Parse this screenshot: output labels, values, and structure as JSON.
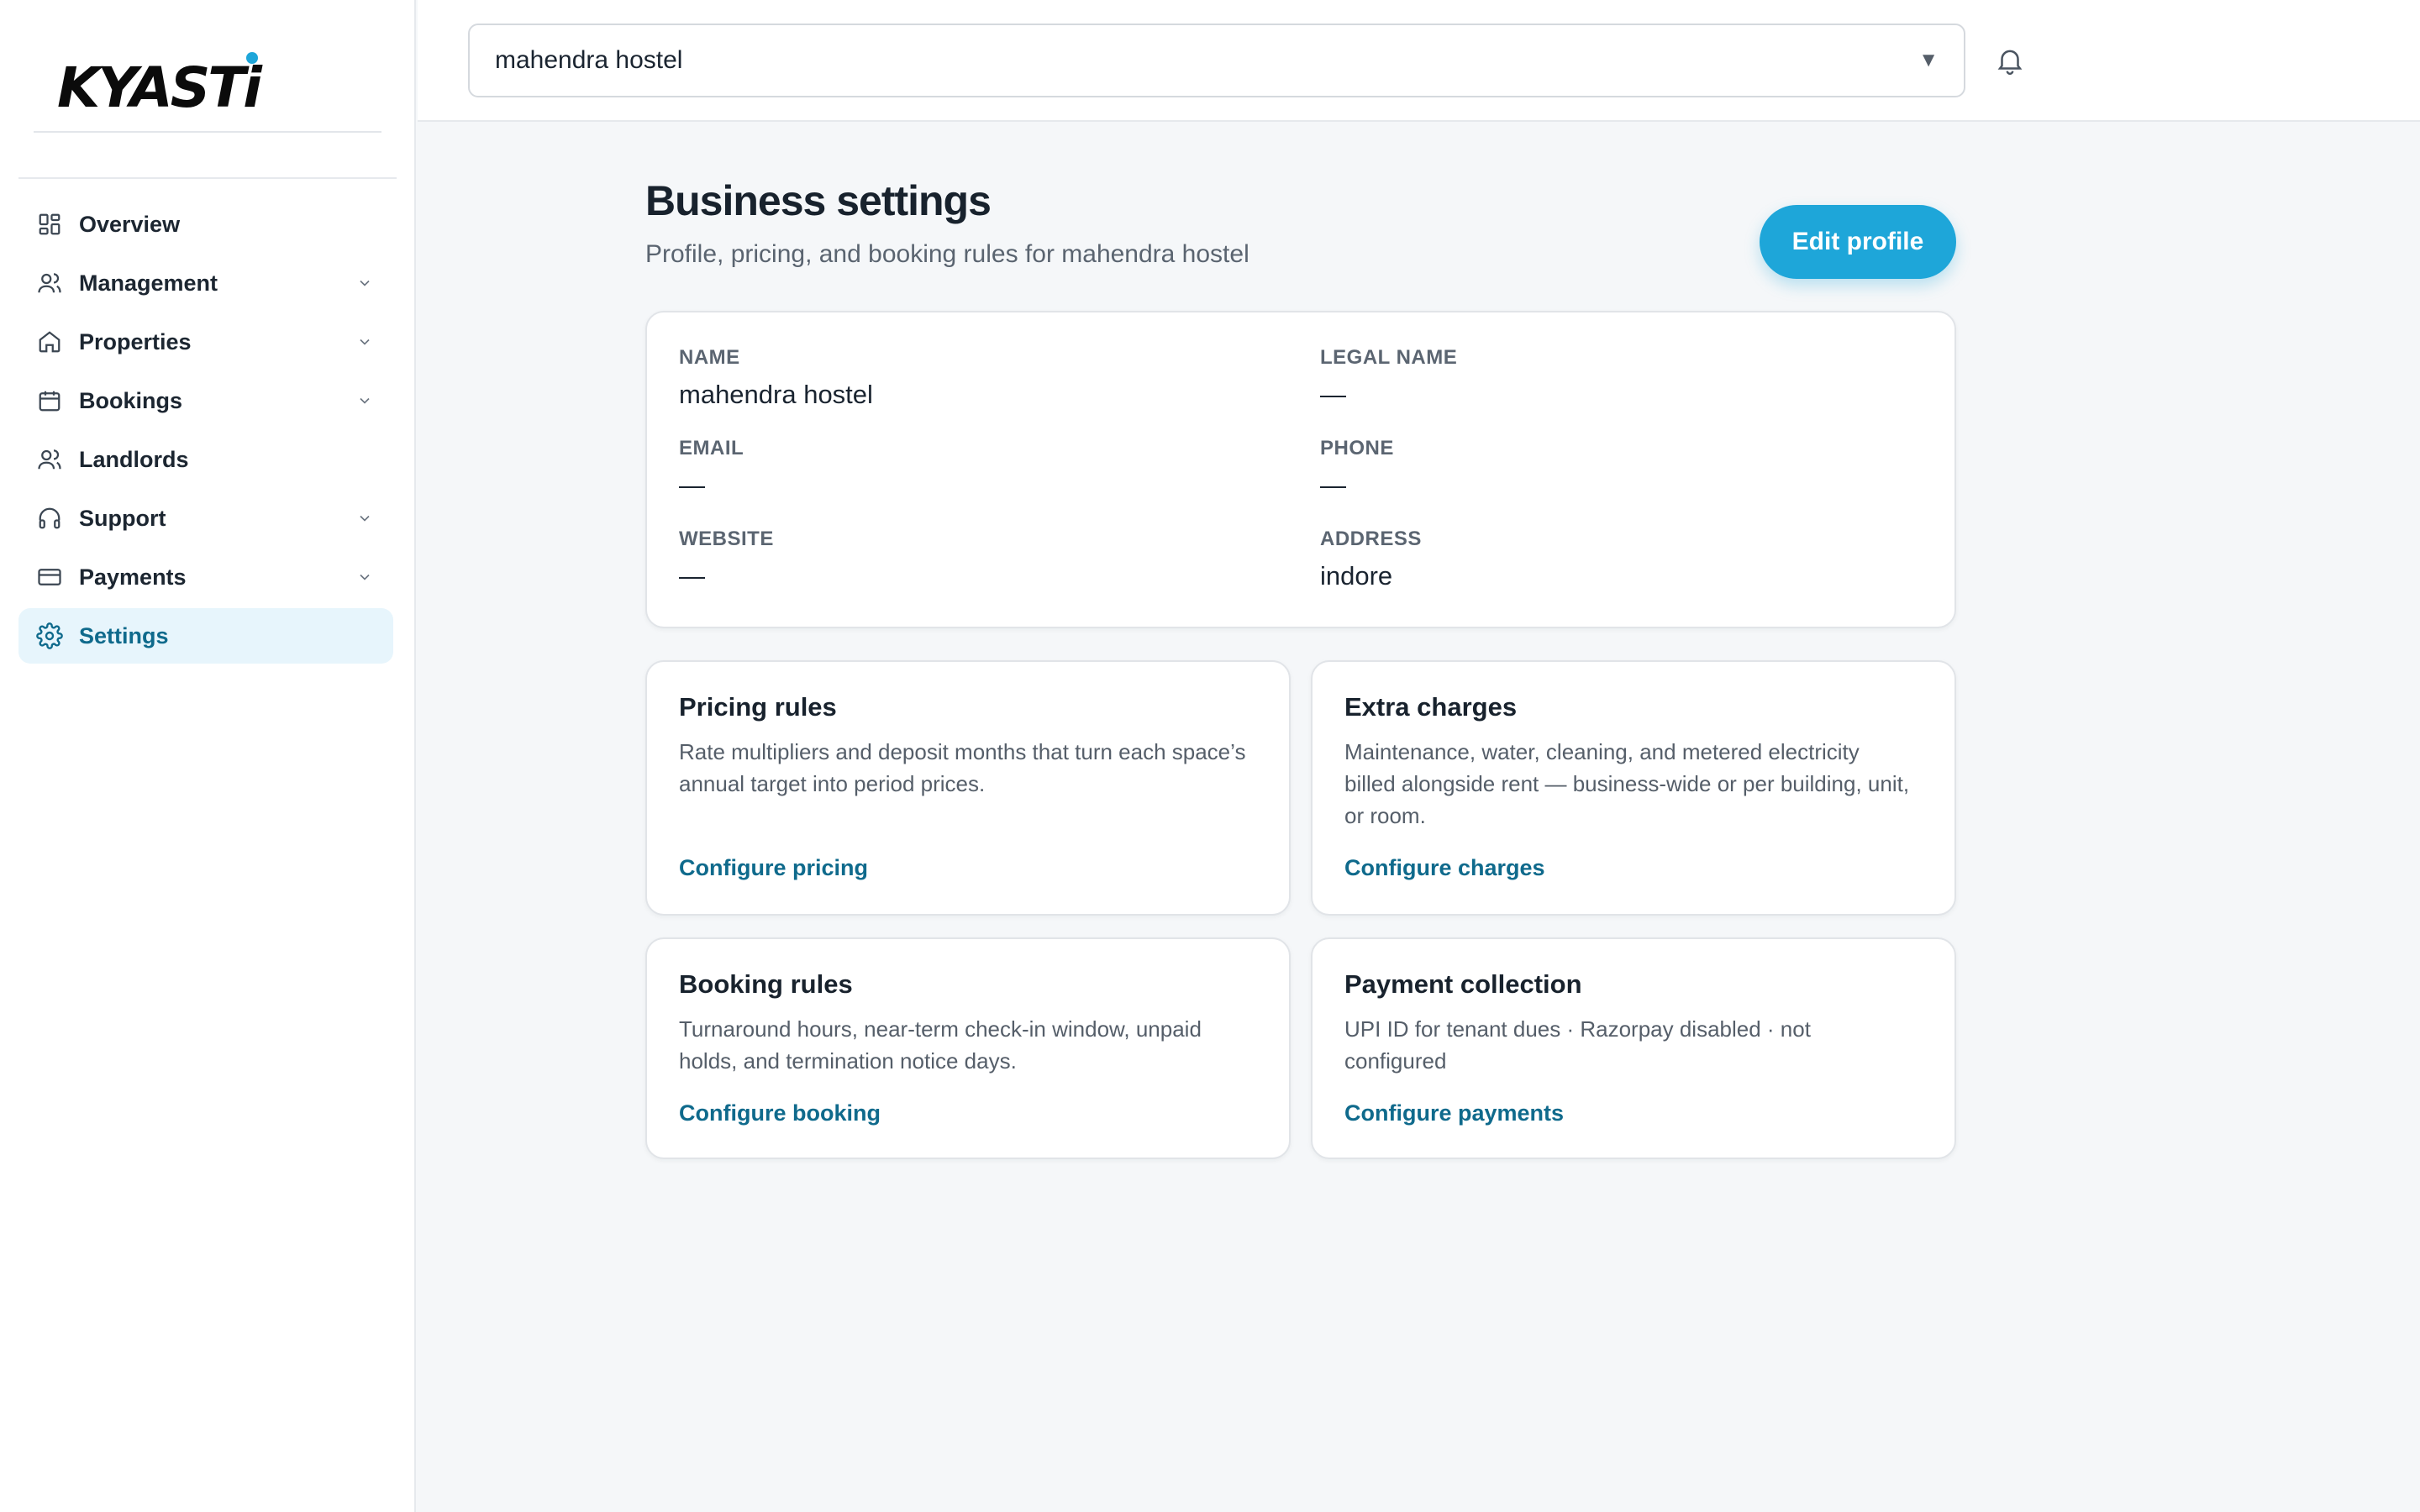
{
  "brand": {
    "logo_text_k": "K",
    "logo_text_mid": "YAST",
    "logo_text_i": "i"
  },
  "sidebar": {
    "items": [
      {
        "label": "Overview",
        "icon": "grid-icon",
        "expandable": false,
        "active": false
      },
      {
        "label": "Management",
        "icon": "users-icon",
        "expandable": true,
        "active": false
      },
      {
        "label": "Properties",
        "icon": "home-icon",
        "expandable": true,
        "active": false
      },
      {
        "label": "Bookings",
        "icon": "calendar-icon",
        "expandable": true,
        "active": false
      },
      {
        "label": "Landlords",
        "icon": "users-icon",
        "expandable": false,
        "active": false
      },
      {
        "label": "Support",
        "icon": "headphones-icon",
        "expandable": true,
        "active": false
      },
      {
        "label": "Payments",
        "icon": "credit-card-icon",
        "expandable": true,
        "active": false
      },
      {
        "label": "Settings",
        "icon": "gear-icon",
        "expandable": false,
        "active": true
      }
    ]
  },
  "topbar": {
    "selected_business": "mahendra hostel",
    "caret": "▼"
  },
  "page": {
    "title": "Business settings",
    "subtitle": "Profile, pricing, and booking rules for mahendra hostel",
    "edit_button": "Edit profile"
  },
  "profile": {
    "name_label": "NAME",
    "name_value": "mahendra hostel",
    "legal_label": "LEGAL NAME",
    "legal_value": "—",
    "email_label": "EMAIL",
    "email_value": "—",
    "phone_label": "PHONE",
    "phone_value": "—",
    "website_label": "WEBSITE",
    "website_value": "—",
    "address_label": "ADDRESS",
    "address_value": "indore"
  },
  "cards": {
    "pricing": {
      "title": "Pricing rules",
      "desc": "Rate multipliers and deposit months that turn each space’s annual target into period prices.",
      "link": "Configure pricing"
    },
    "charges": {
      "title": "Extra charges",
      "desc": "Maintenance, water, cleaning, and metered electricity billed alongside rent — business-wide or per building, unit, or room.",
      "link": "Configure charges"
    },
    "booking": {
      "title": "Booking rules",
      "desc": "Turnaround hours, near-term check-in window, unpaid holds, and termination notice days.",
      "link": "Configure booking"
    },
    "payments": {
      "title": "Payment collection",
      "desc": "UPI ID for tenant dues · Razorpay disabled · not configured",
      "link": "Configure payments"
    }
  },
  "colors": {
    "accent": "#1ea6d9",
    "link": "#0f6a8c",
    "active_bg": "#e7f5fc"
  }
}
